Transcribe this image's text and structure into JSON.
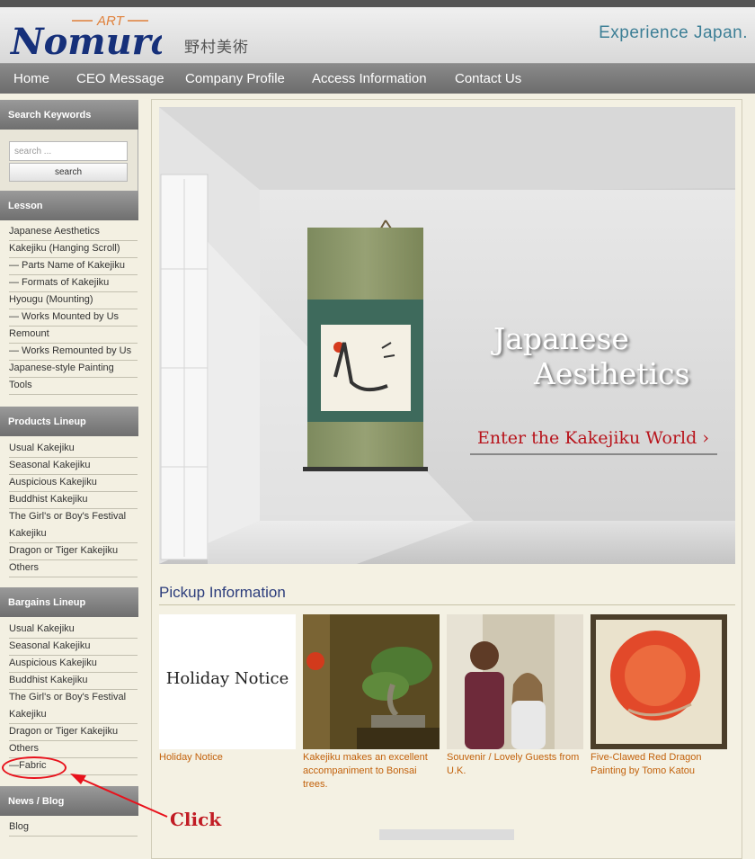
{
  "header": {
    "logo_top": "ART",
    "logo_main": "Nomura",
    "logo_jp": "野村美術",
    "tagline": "Experience Japan."
  },
  "nav": [
    "Home",
    "CEO Message",
    "Company Profile",
    "Access Information",
    "Contact Us"
  ],
  "sidebar": {
    "search": {
      "heading": "Search Keywords",
      "placeholder": "search ...",
      "button": "search"
    },
    "lesson": {
      "heading": "Lesson",
      "items": [
        "Japanese Aesthetics",
        "Kakejiku (Hanging Scroll)",
        "— Parts Name of Kakejiku",
        "— Formats of Kakejiku",
        "Hyougu (Mounting)",
        "— Works Mounted by Us",
        "Remount",
        "— Works Remounted by Us",
        "Japanese-style Painting",
        "Tools"
      ]
    },
    "products": {
      "heading": "Products Lineup",
      "items": [
        "Usual Kakejiku",
        "Seasonal Kakejiku",
        "Auspicious Kakejiku",
        "Buddhist Kakejiku",
        "The Girl's or Boy's Festival",
        "Kakejiku",
        "Dragon or Tiger Kakejiku",
        "Others"
      ]
    },
    "bargains": {
      "heading": "Bargains Lineup",
      "items": [
        "Usual Kakejiku",
        "Seasonal Kakejiku",
        "Auspicious Kakejiku",
        "Buddhist Kakejiku",
        "The Girl's or Boy's Festival",
        "Kakejiku",
        "Dragon or Tiger Kakejiku",
        "Others",
        "—Fabric"
      ]
    },
    "news": {
      "heading": "News / Blog",
      "items": [
        "Blog"
      ]
    }
  },
  "hero": {
    "title_line1": "Japanese",
    "title_line2": "Aesthetics",
    "cta": "Enter the Kakejiku World ›"
  },
  "pickup": {
    "title": "Pickup Information",
    "cards": [
      {
        "thumb_text": "Holiday Notice",
        "label": "Holiday Notice"
      },
      {
        "label": "Kakejiku makes an excellent accompaniment to Bonsai trees."
      },
      {
        "label": "Souvenir / Lovely Guests from U.K."
      },
      {
        "label": "Five-Clawed Red Dragon Painting by Tomo Katou"
      }
    ]
  },
  "annotation": {
    "text": "Click",
    "color": "#e8121c"
  },
  "colors": {
    "nav_bg": "#6c6c6c",
    "accent_tagline": "#3d7f96",
    "link_orange": "#c2610b",
    "heading_blue": "#2c3d7c",
    "cta_red": "#b8141c"
  }
}
